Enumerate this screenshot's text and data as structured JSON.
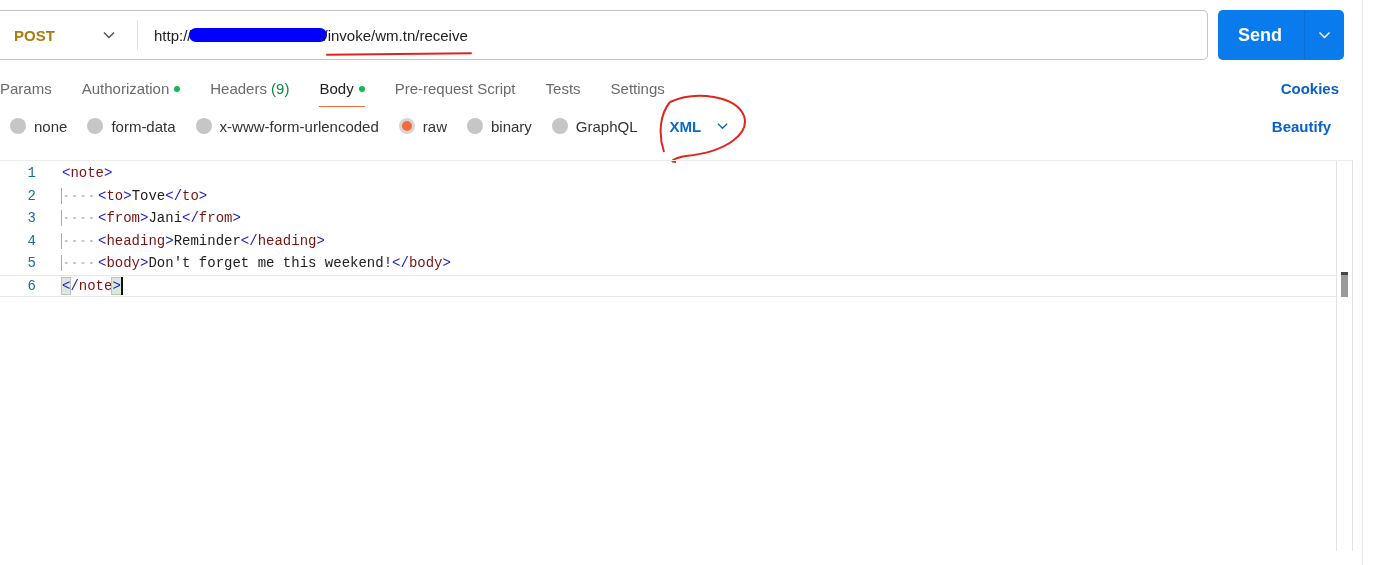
{
  "request": {
    "method": "POST",
    "url_start": "http://",
    "url_end": "/invoke/wm.tn/receive",
    "send_label": "Send"
  },
  "tabs": [
    {
      "label": "Params",
      "selected": false,
      "dot": false
    },
    {
      "label": "Authorization",
      "selected": false,
      "dot": true
    },
    {
      "label": "Headers",
      "count": "(9)",
      "selected": false,
      "dot": false
    },
    {
      "label": "Body",
      "selected": true,
      "dot": true
    },
    {
      "label": "Pre-request Script",
      "selected": false,
      "dot": false
    },
    {
      "label": "Tests",
      "selected": false,
      "dot": false
    },
    {
      "label": "Settings",
      "selected": false,
      "dot": false
    }
  ],
  "cookies_link": "Cookies",
  "body_types": [
    {
      "label": "none",
      "selected": false
    },
    {
      "label": "form-data",
      "selected": false
    },
    {
      "label": "x-www-form-urlencoded",
      "selected": false
    },
    {
      "label": "raw",
      "selected": true
    },
    {
      "label": "binary",
      "selected": false
    },
    {
      "label": "GraphQL",
      "selected": false
    }
  ],
  "language": "XML",
  "beautify_link": "Beautify",
  "editor": {
    "lines": [
      {
        "number": "1",
        "indent": false,
        "active": false,
        "tokens": [
          {
            "kind": "punct",
            "text": "<"
          },
          {
            "kind": "name",
            "text": "note"
          },
          {
            "kind": "punct",
            "text": ">"
          }
        ]
      },
      {
        "number": "2",
        "indent": true,
        "active": false,
        "tokens": [
          {
            "kind": "punct",
            "text": "<"
          },
          {
            "kind": "name",
            "text": "to"
          },
          {
            "kind": "punct",
            "text": ">"
          },
          {
            "kind": "text",
            "text": "Tove"
          },
          {
            "kind": "punct",
            "text": "</"
          },
          {
            "kind": "name",
            "text": "to"
          },
          {
            "kind": "punct",
            "text": ">"
          }
        ]
      },
      {
        "number": "3",
        "indent": true,
        "active": false,
        "tokens": [
          {
            "kind": "punct",
            "text": "<"
          },
          {
            "kind": "name",
            "text": "from"
          },
          {
            "kind": "punct",
            "text": ">"
          },
          {
            "kind": "text",
            "text": "Jani"
          },
          {
            "kind": "punct",
            "text": "</"
          },
          {
            "kind": "name",
            "text": "from"
          },
          {
            "kind": "punct",
            "text": ">"
          }
        ]
      },
      {
        "number": "4",
        "indent": true,
        "active": false,
        "tokens": [
          {
            "kind": "punct",
            "text": "<"
          },
          {
            "kind": "name",
            "text": "heading"
          },
          {
            "kind": "punct",
            "text": ">"
          },
          {
            "kind": "text",
            "text": "Reminder"
          },
          {
            "kind": "punct",
            "text": "</"
          },
          {
            "kind": "name",
            "text": "heading"
          },
          {
            "kind": "punct",
            "text": ">"
          }
        ]
      },
      {
        "number": "5",
        "indent": true,
        "active": false,
        "tokens": [
          {
            "kind": "punct",
            "text": "<"
          },
          {
            "kind": "name",
            "text": "body"
          },
          {
            "kind": "punct",
            "text": ">"
          },
          {
            "kind": "text",
            "text": "Don't forget me this weekend!"
          },
          {
            "kind": "punct",
            "text": "</"
          },
          {
            "kind": "name",
            "text": "body"
          },
          {
            "kind": "punct",
            "text": ">"
          }
        ]
      },
      {
        "number": "6",
        "indent": false,
        "active": true,
        "tokens": [
          {
            "kind": "match",
            "text": "<"
          },
          {
            "kind": "punct",
            "text": "/"
          },
          {
            "kind": "name",
            "text": "note"
          },
          {
            "kind": "match",
            "text": ">"
          }
        ]
      }
    ]
  }
}
